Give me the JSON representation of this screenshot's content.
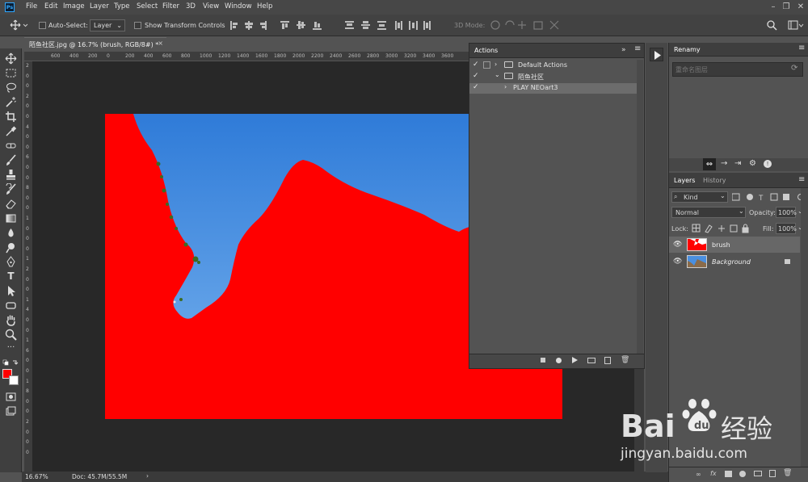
{
  "app": {
    "ps_logo": "Ps"
  },
  "menu": [
    "File",
    "Edit",
    "Image",
    "Layer",
    "Type",
    "Select",
    "Filter",
    "3D",
    "View",
    "Window",
    "Help"
  ],
  "options_bar": {
    "auto_select_label": "Auto-Select:",
    "auto_select_value": "Layer",
    "show_transform_label": "Show Transform Controls",
    "mode_3d_label": "3D Mode:"
  },
  "document": {
    "tab_title": "陌鱼社区.jpg @ 16.7% (brush, RGB/8#) *",
    "close_glyph": "×"
  },
  "ruler": {
    "h_ticks": [
      "600",
      "400",
      "200",
      "0",
      "200",
      "400",
      "600",
      "800",
      "1000",
      "1200",
      "1400",
      "1600",
      "1800",
      "2000",
      "2200",
      "2400",
      "2600",
      "2800",
      "3000",
      "3200",
      "3400",
      "3600"
    ],
    "v_ticks": [
      "2",
      "0",
      "0",
      "2",
      "0",
      "0",
      "4",
      "0",
      "0",
      "6",
      "0",
      "0",
      "8",
      "0",
      "0",
      "1",
      "0",
      "0",
      "0",
      "1",
      "2",
      "0",
      "0",
      "1",
      "4",
      "0",
      "0",
      "1",
      "6",
      "0",
      "0",
      "1",
      "8",
      "0",
      "0",
      "2",
      "0",
      "0",
      "0"
    ]
  },
  "status": {
    "zoom": "16.67%",
    "doc": "Doc: 45.7M/55.5M",
    "arrow": "›"
  },
  "actions_panel": {
    "title": "Actions",
    "rows": [
      {
        "name": "Default Actions",
        "checked": true,
        "type": "set",
        "expanded": false
      },
      {
        "name": "陌鱼社区",
        "checked": true,
        "type": "set",
        "expanded": true
      },
      {
        "name": "PLAY NEOart3",
        "checked": true,
        "type": "action",
        "expanded": false
      }
    ]
  },
  "renamy_panel": {
    "title": "Renamy",
    "search_placeholder": "重命名图层"
  },
  "layers_panel": {
    "tabs": [
      "Layers",
      "History"
    ],
    "filter_label": "Kind",
    "blend_mode": "Normal",
    "opacity_label": "Opacity:",
    "opacity_value": "100%",
    "lock_label": "Lock:",
    "fill_label": "Fill:",
    "fill_value": "100%",
    "layers": [
      {
        "name": "brush",
        "visible": true,
        "selected": true,
        "locked": false
      },
      {
        "name": "Background",
        "visible": true,
        "selected": false,
        "locked": true
      }
    ]
  },
  "watermark": {
    "brand_text": "Bai",
    "brand_suffix": "经验",
    "url": "jingyan.baidu.com"
  },
  "colors": {
    "foreground": "#ff0000",
    "background": "#ffffff",
    "sky": "#4a8fe0",
    "mask_red": "#ff0000"
  },
  "icons": [
    "ps-logo-icon",
    "move-icon",
    "marquee-icon",
    "lasso-icon",
    "magic-wand-icon",
    "crop-icon",
    "eyedropper-icon",
    "heal-icon",
    "brush-icon",
    "stamp-icon",
    "history-brush-icon",
    "eraser-icon",
    "gradient-icon",
    "blur-icon",
    "dodge-icon",
    "pen-icon",
    "type-icon",
    "path-select-icon",
    "shape-icon",
    "hand-icon",
    "zoom-icon",
    "more-tools-icon",
    "quick-mask-icon",
    "screen-mode-icon",
    "folder-icon",
    "play-icon",
    "stop-icon",
    "record-icon",
    "new-icon",
    "trash-icon",
    "eye-icon",
    "lock-icon",
    "search-icon",
    "chevron-right-icon",
    "chevron-down-icon",
    "menu-icon",
    "paw-icon"
  ]
}
